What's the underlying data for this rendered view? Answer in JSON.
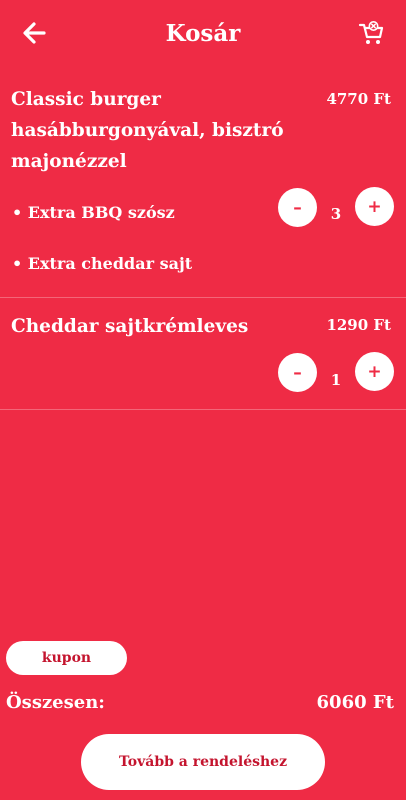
{
  "header": {
    "title": "Kosár",
    "back_icon": "arrow-left-icon",
    "cart_icon": "cart-remove-icon"
  },
  "cart": {
    "items": [
      {
        "name": "Classic burger hasábburgonyával, bisztró majonézzel",
        "price": "4770 Ft",
        "quantity": "3",
        "extras": [
          "• Extra BBQ szósz",
          "• Extra cheddar sajt"
        ]
      },
      {
        "name": "Cheddar sajtkrémleves",
        "price": "1290 Ft",
        "quantity": "1",
        "extras": []
      }
    ],
    "minus_label": "–",
    "plus_label": "+"
  },
  "footer": {
    "coupon_label": "kupon",
    "total_label": "Összesen:",
    "total_value": "6060 Ft",
    "proceed_label": "Tovább a rendeléshez"
  },
  "colors": {
    "background": "#ef2b45",
    "accent_text": "#c4142e",
    "button_bg": "#ffffff"
  }
}
